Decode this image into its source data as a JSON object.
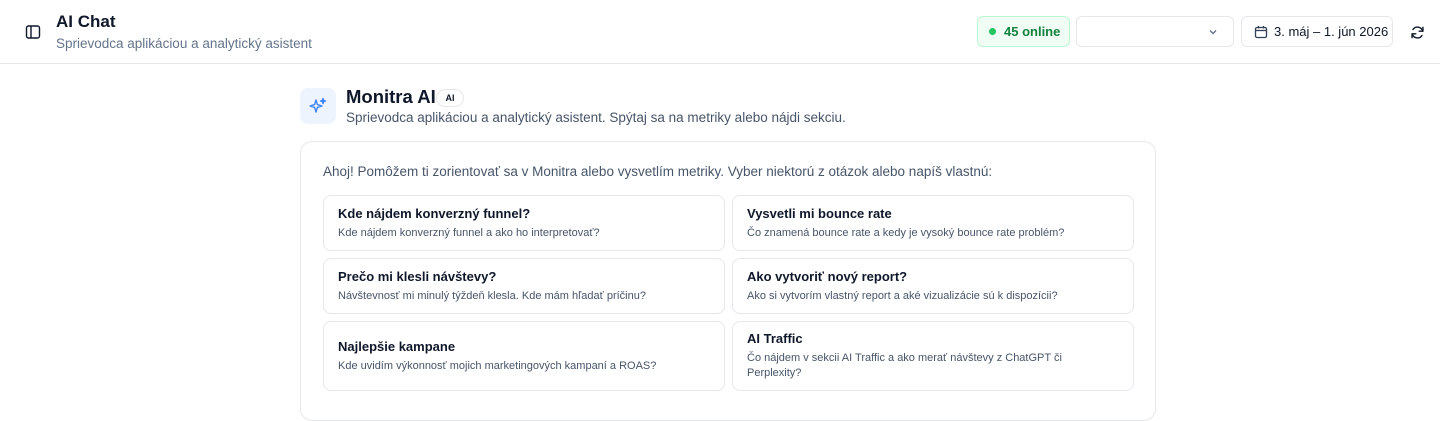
{
  "header": {
    "title": "AI Chat",
    "subtitle": "Sprievodca aplikáciou a analytický asistent",
    "online_badge": "45 online",
    "select_value": "",
    "date_range": "3. máj – 1. jún 2026"
  },
  "assistant": {
    "name": "Monitra AI",
    "badge": "AI",
    "description": "Sprievodca aplikáciou a analytický asistent. Spýtaj sa na metriky alebo nájdi sekciu."
  },
  "chat": {
    "greeting": "Ahoj! Pomôžem ti zorientovať sa v Monitra alebo vysvetlím metriky. Vyber niektorú z otázok alebo napíš vlastnú:",
    "suggestions": [
      {
        "title": "Kde nájdem konverzný funnel?",
        "desc": "Kde nájdem konverzný funnel a ako ho interpretovať?"
      },
      {
        "title": "Vysvetli mi bounce rate",
        "desc": "Čo znamená bounce rate a kedy je vysoký bounce rate problém?"
      },
      {
        "title": "Prečo mi klesli návštevy?",
        "desc": "Návštevnosť mi minulý týždeň klesla. Kde mám hľadať príčinu?"
      },
      {
        "title": "Ako vytvoriť nový report?",
        "desc": "Ako si vytvorím vlastný report a aké vizualizácie sú k dispozícii?"
      },
      {
        "title": "Najlepšie kampane",
        "desc": "Kde uvidím výkonnosť mojich marketingových kampaní a ROAS?"
      },
      {
        "title": "AI Traffic",
        "desc": "Čo nájdem v sekcii AI Traffic a ako merať návštevy z ChatGPT či Perplexity?"
      }
    ]
  },
  "icons": {
    "sidebar": "sidebar-toggle-icon",
    "online": "status-dot-icon",
    "chevron": "chevron-down-icon",
    "calendar": "calendar-icon",
    "refresh": "refresh-icon",
    "assistant": "sparkles-icon"
  },
  "colors": {
    "online_text": "#15803d",
    "online_bg": "#f0fdf4",
    "online_dot": "#22c55e",
    "ai_icon": "#3b82f6",
    "ai_icon_bg": "#eef4fd"
  }
}
